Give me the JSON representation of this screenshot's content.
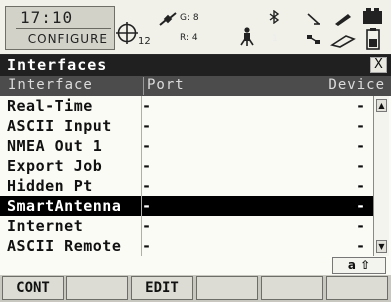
{
  "status": {
    "time": "17:10",
    "mode": "CONFIGURE",
    "sat_count": "12",
    "gps_label": "G: 8",
    "glonass_label": "R: 4",
    "battery_slot": "1"
  },
  "title": {
    "text": "Interfaces",
    "close_label": "X"
  },
  "table": {
    "headers": {
      "interface": "Interface",
      "port": "Port",
      "device": "Device"
    },
    "rows": [
      {
        "interface": "Real-Time",
        "port": "-",
        "device": "-"
      },
      {
        "interface": "ASCII Input",
        "port": "-",
        "device": "-"
      },
      {
        "interface": "NMEA Out 1",
        "port": "-",
        "device": "-"
      },
      {
        "interface": "Export Job",
        "port": "-",
        "device": "-"
      },
      {
        "interface": "Hidden Pt",
        "port": "-",
        "device": "-"
      },
      {
        "interface": "SmartAntenna",
        "port": "-",
        "device": "-"
      },
      {
        "interface": "Internet",
        "port": "-",
        "device": "-"
      },
      {
        "interface": "ASCII Remote",
        "port": "-",
        "device": "-"
      }
    ],
    "selected_index": 5
  },
  "scroll": {
    "up": "▲",
    "down": "▼"
  },
  "input_mode": "a ⇧",
  "softkeys": [
    "CONT",
    "",
    "EDIT",
    "",
    "",
    ""
  ]
}
